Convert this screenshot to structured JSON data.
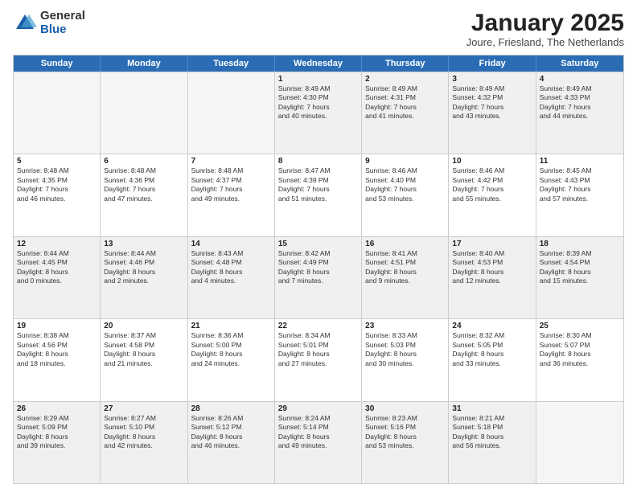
{
  "logo": {
    "general": "General",
    "blue": "Blue"
  },
  "title": "January 2025",
  "subtitle": "Joure, Friesland, The Netherlands",
  "header_days": [
    "Sunday",
    "Monday",
    "Tuesday",
    "Wednesday",
    "Thursday",
    "Friday",
    "Saturday"
  ],
  "weeks": [
    [
      {
        "day": "",
        "info": ""
      },
      {
        "day": "",
        "info": ""
      },
      {
        "day": "",
        "info": ""
      },
      {
        "day": "1",
        "info": "Sunrise: 8:49 AM\nSunset: 4:30 PM\nDaylight: 7 hours\nand 40 minutes."
      },
      {
        "day": "2",
        "info": "Sunrise: 8:49 AM\nSunset: 4:31 PM\nDaylight: 7 hours\nand 41 minutes."
      },
      {
        "day": "3",
        "info": "Sunrise: 8:49 AM\nSunset: 4:32 PM\nDaylight: 7 hours\nand 43 minutes."
      },
      {
        "day": "4",
        "info": "Sunrise: 8:49 AM\nSunset: 4:33 PM\nDaylight: 7 hours\nand 44 minutes."
      }
    ],
    [
      {
        "day": "5",
        "info": "Sunrise: 8:48 AM\nSunset: 4:35 PM\nDaylight: 7 hours\nand 46 minutes."
      },
      {
        "day": "6",
        "info": "Sunrise: 8:48 AM\nSunset: 4:36 PM\nDaylight: 7 hours\nand 47 minutes."
      },
      {
        "day": "7",
        "info": "Sunrise: 8:48 AM\nSunset: 4:37 PM\nDaylight: 7 hours\nand 49 minutes."
      },
      {
        "day": "8",
        "info": "Sunrise: 8:47 AM\nSunset: 4:39 PM\nDaylight: 7 hours\nand 51 minutes."
      },
      {
        "day": "9",
        "info": "Sunrise: 8:46 AM\nSunset: 4:40 PM\nDaylight: 7 hours\nand 53 minutes."
      },
      {
        "day": "10",
        "info": "Sunrise: 8:46 AM\nSunset: 4:42 PM\nDaylight: 7 hours\nand 55 minutes."
      },
      {
        "day": "11",
        "info": "Sunrise: 8:45 AM\nSunset: 4:43 PM\nDaylight: 7 hours\nand 57 minutes."
      }
    ],
    [
      {
        "day": "12",
        "info": "Sunrise: 8:44 AM\nSunset: 4:45 PM\nDaylight: 8 hours\nand 0 minutes."
      },
      {
        "day": "13",
        "info": "Sunrise: 8:44 AM\nSunset: 4:46 PM\nDaylight: 8 hours\nand 2 minutes."
      },
      {
        "day": "14",
        "info": "Sunrise: 8:43 AM\nSunset: 4:48 PM\nDaylight: 8 hours\nand 4 minutes."
      },
      {
        "day": "15",
        "info": "Sunrise: 8:42 AM\nSunset: 4:49 PM\nDaylight: 8 hours\nand 7 minutes."
      },
      {
        "day": "16",
        "info": "Sunrise: 8:41 AM\nSunset: 4:51 PM\nDaylight: 8 hours\nand 9 minutes."
      },
      {
        "day": "17",
        "info": "Sunrise: 8:40 AM\nSunset: 4:53 PM\nDaylight: 8 hours\nand 12 minutes."
      },
      {
        "day": "18",
        "info": "Sunrise: 8:39 AM\nSunset: 4:54 PM\nDaylight: 8 hours\nand 15 minutes."
      }
    ],
    [
      {
        "day": "19",
        "info": "Sunrise: 8:38 AM\nSunset: 4:56 PM\nDaylight: 8 hours\nand 18 minutes."
      },
      {
        "day": "20",
        "info": "Sunrise: 8:37 AM\nSunset: 4:58 PM\nDaylight: 8 hours\nand 21 minutes."
      },
      {
        "day": "21",
        "info": "Sunrise: 8:36 AM\nSunset: 5:00 PM\nDaylight: 8 hours\nand 24 minutes."
      },
      {
        "day": "22",
        "info": "Sunrise: 8:34 AM\nSunset: 5:01 PM\nDaylight: 8 hours\nand 27 minutes."
      },
      {
        "day": "23",
        "info": "Sunrise: 8:33 AM\nSunset: 5:03 PM\nDaylight: 8 hours\nand 30 minutes."
      },
      {
        "day": "24",
        "info": "Sunrise: 8:32 AM\nSunset: 5:05 PM\nDaylight: 8 hours\nand 33 minutes."
      },
      {
        "day": "25",
        "info": "Sunrise: 8:30 AM\nSunset: 5:07 PM\nDaylight: 8 hours\nand 36 minutes."
      }
    ],
    [
      {
        "day": "26",
        "info": "Sunrise: 8:29 AM\nSunset: 5:09 PM\nDaylight: 8 hours\nand 39 minutes."
      },
      {
        "day": "27",
        "info": "Sunrise: 8:27 AM\nSunset: 5:10 PM\nDaylight: 8 hours\nand 42 minutes."
      },
      {
        "day": "28",
        "info": "Sunrise: 8:26 AM\nSunset: 5:12 PM\nDaylight: 8 hours\nand 46 minutes."
      },
      {
        "day": "29",
        "info": "Sunrise: 8:24 AM\nSunset: 5:14 PM\nDaylight: 8 hours\nand 49 minutes."
      },
      {
        "day": "30",
        "info": "Sunrise: 8:23 AM\nSunset: 5:16 PM\nDaylight: 8 hours\nand 53 minutes."
      },
      {
        "day": "31",
        "info": "Sunrise: 8:21 AM\nSunset: 5:18 PM\nDaylight: 8 hours\nand 56 minutes."
      },
      {
        "day": "",
        "info": ""
      }
    ]
  ],
  "shaded_rows": [
    0,
    2,
    4
  ],
  "empty_cells": {
    "0": [
      0,
      1,
      2
    ],
    "4": [
      6
    ]
  }
}
